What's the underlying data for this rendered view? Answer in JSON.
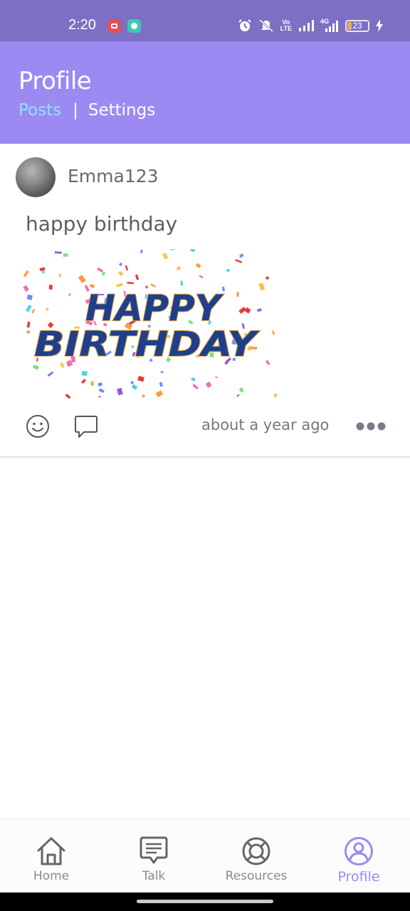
{
  "status_bar": {
    "time": "2:20",
    "network_label_top": "Vo",
    "network_label_bottom": "LTE",
    "network_4g": "4G",
    "battery": "23"
  },
  "header": {
    "title": "Profile",
    "tabs": [
      {
        "label": "Posts",
        "active": true
      },
      {
        "label": "Settings",
        "active": false
      }
    ],
    "separator": "|"
  },
  "post": {
    "username": "Emma123",
    "text": "happy birthday",
    "image_caption_line1": "HAPPY",
    "image_caption_line2": "BIRTHDAY",
    "timestamp": "about a year ago"
  },
  "bottom_nav": {
    "items": [
      {
        "label": "Home",
        "icon": "home-icon",
        "active": false
      },
      {
        "label": "Talk",
        "icon": "chat-icon",
        "active": false
      },
      {
        "label": "Resources",
        "icon": "lifebuoy-icon",
        "active": false
      },
      {
        "label": "Profile",
        "icon": "profile-icon",
        "active": true
      }
    ]
  },
  "colors": {
    "status_bar": "#7d6fc4",
    "header": "#9d89f2",
    "active_tab": "#8fe3fb",
    "active_nav": "#9d89f2",
    "birthday_text": "#1f3f8c"
  }
}
